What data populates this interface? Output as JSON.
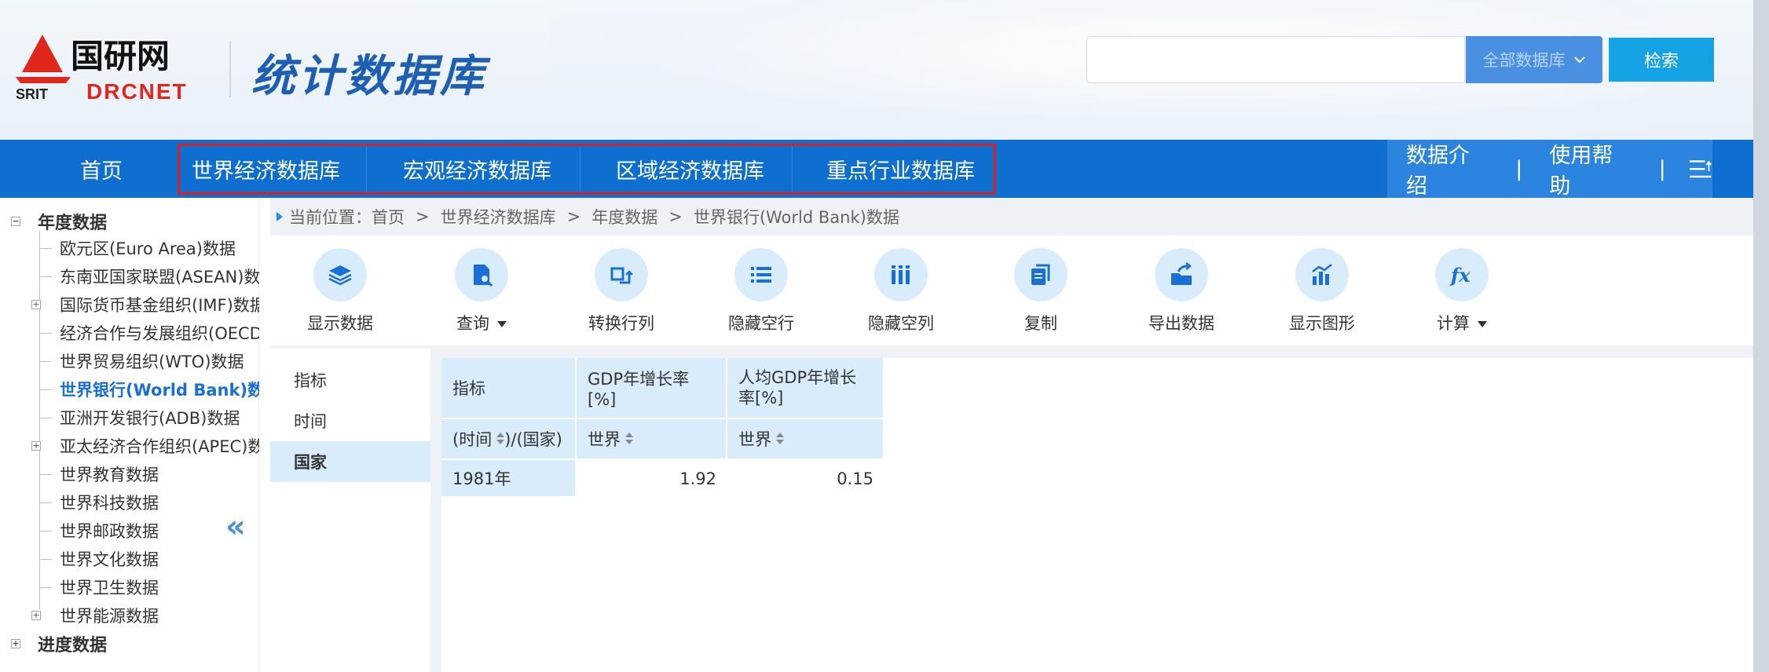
{
  "brand": {
    "logo_text_cn": "国研网",
    "logo_text_en": "DRCNET",
    "logo_sub": "SRIT",
    "site_title": "统计数据库"
  },
  "search": {
    "placeholder": "",
    "scope_label": "全部数据库",
    "button_label": "检索"
  },
  "nav": {
    "home": "首页",
    "items": [
      "世界经济数据库",
      "宏观经济数据库",
      "区域经济数据库",
      "重点行业数据库"
    ],
    "right_items": [
      "数据介绍",
      "使用帮助"
    ],
    "separator": "|"
  },
  "sidebar": {
    "roots": [
      {
        "label": "年度数据",
        "toggle": "−"
      },
      {
        "label": "进度数据",
        "toggle": "+"
      }
    ],
    "children": [
      {
        "label": "欧元区(Euro Area)数据",
        "toggle": ""
      },
      {
        "label": "东南亚国家联盟(ASEAN)数",
        "toggle": ""
      },
      {
        "label": "国际货币基金组织(IMF)数据",
        "toggle": "+"
      },
      {
        "label": "经济合作与发展组织(OECD",
        "toggle": ""
      },
      {
        "label": "世界贸易组织(WTO)数据",
        "toggle": ""
      },
      {
        "label": "世界银行(World Bank)数据",
        "toggle": ""
      },
      {
        "label": "亚洲开发银行(ADB)数据",
        "toggle": ""
      },
      {
        "label": "亚太经济合作组织(APEC)数",
        "toggle": "+"
      },
      {
        "label": "世界教育数据",
        "toggle": ""
      },
      {
        "label": "世界科技数据",
        "toggle": ""
      },
      {
        "label": "世界邮政数据",
        "toggle": ""
      },
      {
        "label": "世界文化数据",
        "toggle": ""
      },
      {
        "label": "世界卫生数据",
        "toggle": ""
      },
      {
        "label": "世界能源数据",
        "toggle": "+"
      }
    ],
    "collapse_glyph": "«"
  },
  "breadcrumb": {
    "prefix": "当前位置：",
    "items": [
      "首页",
      "世界经济数据库",
      "年度数据",
      "世界银行(World Bank)数据"
    ],
    "sep": ">"
  },
  "toolbar": [
    {
      "label": "显示数据",
      "icon": "layers-icon",
      "dropdown": false
    },
    {
      "label": "查询",
      "icon": "search-doc-icon",
      "dropdown": true
    },
    {
      "label": "转换行列",
      "icon": "transpose-icon",
      "dropdown": false
    },
    {
      "label": "隐藏空行",
      "icon": "list-icon",
      "dropdown": false
    },
    {
      "label": "隐藏空列",
      "icon": "columns-icon",
      "dropdown": false
    },
    {
      "label": "复制",
      "icon": "copy-icon",
      "dropdown": false
    },
    {
      "label": "导出数据",
      "icon": "export-icon",
      "dropdown": false
    },
    {
      "label": "显示图形",
      "icon": "chart-icon",
      "dropdown": false
    },
    {
      "label": "计算",
      "icon": "fx-icon",
      "dropdown": true
    }
  ],
  "dimensions": [
    "指标",
    "时间",
    "国家"
  ],
  "table": {
    "corner_top": "指标",
    "corner_bottom_left": "(时间",
    "corner_bottom_right": ")/(国家)",
    "columns": [
      "GDP年增长率[%]",
      "人均GDP年增长率[%]"
    ],
    "column_country": [
      "世界",
      "世界"
    ],
    "rows": [
      {
        "time": "1981年",
        "values": [
          "1.92",
          "0.15"
        ]
      }
    ]
  },
  "colors": {
    "nav_bg": "#0e6fd1",
    "accent": "#1a6fd6",
    "highlight_box": "#e02020",
    "cell_header": "#d9ecfb"
  }
}
